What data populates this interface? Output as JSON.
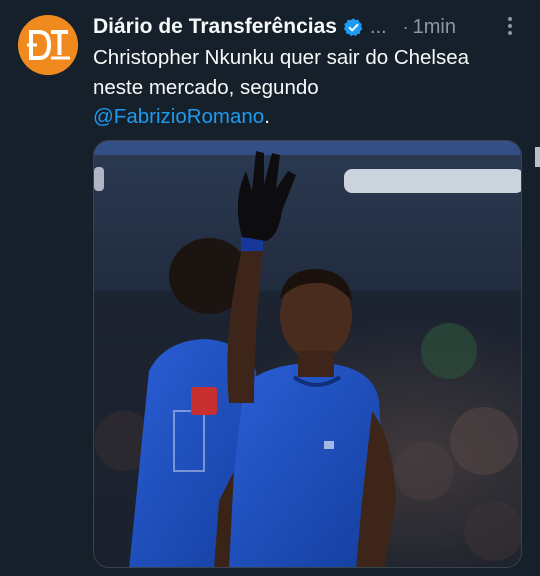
{
  "post": {
    "author_name": "Diário de Transferências",
    "handle": "...",
    "separator": "·",
    "time": "1min",
    "text_line1": "Christopher Nkunku quer sair do Chelsea",
    "text_line2": "neste mercado, segundo",
    "mention": "@FabrizioRomano",
    "trailing": ".",
    "image_alt": "Christopher Nkunku em campo com a camisa do Chelsea, com a mão levantada"
  },
  "avatar": {
    "logo_text": "DT",
    "color": "#f08a1f"
  },
  "icons": {
    "verified": "verified-badge-icon",
    "more": "more-options-icon"
  },
  "colors": {
    "background": "#15202b",
    "accent": "#1d9bf0",
    "muted": "#8b98a5",
    "text": "#f7f9f9"
  }
}
